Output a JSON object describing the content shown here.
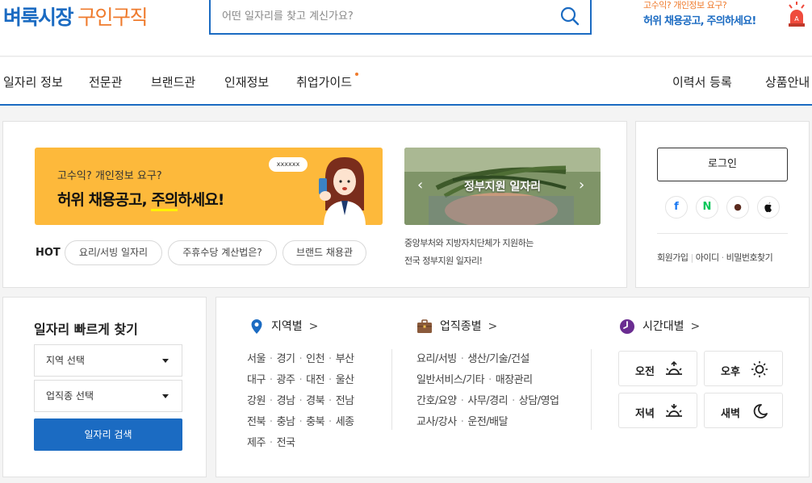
{
  "header": {
    "logo_part1": "벼룩시장",
    "logo_part2": "구인구직",
    "search_placeholder": "어떤 일자리를 찾고 계신가요?",
    "warning_line1": "고수익? 개인정보 요구?",
    "warning_line2": "허위 채용공고, 주의하세요!"
  },
  "nav": {
    "items": [
      "일자리 정보",
      "전문관",
      "브랜드관",
      "인재정보",
      "취업가이드"
    ],
    "right_items": [
      "이력서 등록",
      "상품안내"
    ],
    "accent_color": "#ef7b2d"
  },
  "promo": {
    "banner_line1": "고수익? 개인정보 요구?",
    "banner_line2_a": "허위 채용공고, ",
    "banner_line2_b": "주의",
    "banner_line2_c": "하세요!",
    "bubble_text": "xxxxxx",
    "gov_title": "정부지원 일자리",
    "gov_desc_line1": "중앙부처와 지방자치단체가 지원하는",
    "gov_desc_line2": "전국 정부지원 일자리!",
    "hot_label": "HOT",
    "hot_tags": [
      "요리/서빙 일자리",
      "주휴수당 계산법은?",
      "브랜드 채용관"
    ]
  },
  "login": {
    "button_label": "로그인",
    "sns": [
      {
        "icon": "facebook-icon",
        "glyph": "f",
        "color": "#1877f2"
      },
      {
        "icon": "naver-icon",
        "glyph": "N",
        "color": "#03c75a"
      },
      {
        "icon": "kakao-talk-icon",
        "glyph": "●",
        "color": "#5a2a1e"
      },
      {
        "icon": "apple-icon",
        "glyph": "",
        "color": "#111111"
      }
    ],
    "signup": "회원가입",
    "id": "아이디",
    "password": "비밀번호찾기"
  },
  "quick_search": {
    "title": "일자리 빠르게 찾기",
    "region_select": "지역 선택",
    "job_select": "업직종 선택",
    "search_button": "일자리 검색"
  },
  "categories": {
    "region_title": "지역별",
    "region_rows": [
      [
        "서울",
        "경기",
        "인천",
        "부산"
      ],
      [
        "대구",
        "광주",
        "대전",
        "울산"
      ],
      [
        "강원",
        "경남",
        "경북",
        "전남"
      ],
      [
        "전북",
        "충남",
        "충북",
        "세종"
      ],
      [
        "제주",
        "전국"
      ]
    ],
    "job_title": "업직종별",
    "job_rows": [
      [
        "요리/서빙",
        "생산/기술/건설"
      ],
      [
        "일반서비스/기타",
        "매장관리"
      ],
      [
        "간호/요양",
        "사무/경리",
        "상담/영업"
      ],
      [
        "교사/강사",
        "운전/배달"
      ]
    ],
    "time_title": "시간대별",
    "time_buttons": [
      "오전",
      "오후",
      "저녁",
      "새벽"
    ],
    "chevron": ">"
  },
  "colors": {
    "brand_blue": "#1b6bc2",
    "brand_orange": "#ef7b2d",
    "banner_yellow": "#fdb93b"
  }
}
